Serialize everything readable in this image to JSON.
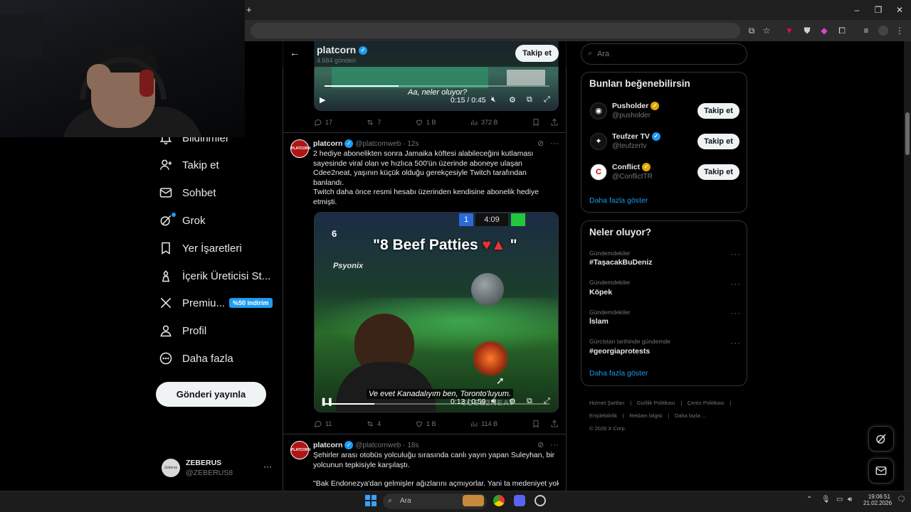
{
  "browser": {
    "new_tab": "+",
    "minimize": "–",
    "maximize": "❐",
    "close": "✕"
  },
  "header": {
    "title": "platcorn",
    "subtitle": "4.684 gönderi",
    "follow": "Takip et"
  },
  "nav": {
    "items": [
      {
        "label": "Bildirimler"
      },
      {
        "label": "Takip et"
      },
      {
        "label": "Sohbet"
      },
      {
        "label": "Grok"
      },
      {
        "label": "Yer İşaretleri"
      },
      {
        "label": "İçerik Üreticisi St..."
      },
      {
        "label": "Premiu..."
      },
      {
        "label": "Profil"
      },
      {
        "label": "Daha fazla"
      }
    ],
    "premium_badge": "%50 indirim",
    "post_button": "Gönderi yayınla",
    "account": {
      "name": "ZEBERUS",
      "handle": "@ZEBERUS8",
      "avatar_text": "Zeberus",
      "more": "···"
    }
  },
  "video1": {
    "caption": "Aa, neler oluyor?",
    "time": "0:15 / 0:45",
    "progress": 0.33
  },
  "tweet1_actions": {
    "replies": "17",
    "reposts": "7",
    "likes": "1 B",
    "views": "372 B"
  },
  "tweet2": {
    "author": "platcorn",
    "handle": "@platcornweb",
    "time": "· 12s",
    "avatar_text": "PLATCORN",
    "text1": "2 hediye abonelikten sonra Jamaika köftesi alabileceğini kutlaması sayesinde viral olan ve hızlıca 500'ün üzerinde aboneye ulaşan Cdee2neat, yaşının küçük olduğu gerekçesiyle Twitch tarafından banlandı.",
    "text2": "Twitch daha önce resmi hesabı üzerinden kendisine abonelik hediye etmişti.",
    "video": {
      "overlay_title": "\"8 Beef Patties",
      "overlay_close": "\"",
      "hud_left": "6",
      "hud_team": "1",
      "hud_clock": "4:09",
      "hud_side": "Psyonix",
      "subtitle": "Ve evet Kanadalıyım ben, Toronto'luyum.",
      "time": "0:13 / 0:59",
      "progress": 0.22,
      "watermark": "CDEE2NEAT"
    },
    "actions": {
      "replies": "11",
      "reposts": "4",
      "likes": "1 B",
      "views": "114 B"
    }
  },
  "tweet3": {
    "author": "platcorn",
    "handle": "@platcornweb",
    "time": "· 18s",
    "avatar_text": "PLATCORN",
    "text1": "Şehirler arası otobüs yolculuğu sırasında canlı yayın yapan Suleyhan, bir yolcunun tepkisiyle karşılaştı.",
    "text2": "\"Bak Endonezya'dan gelmişler ağızlarını açmıyorlar. Yani ta medeniyet yok"
  },
  "search": {
    "placeholder": "Ara"
  },
  "who_to_follow": {
    "title": "Bunları beğenebilirsin",
    "users": [
      {
        "name": "Pusholder",
        "handle": "@pusholder",
        "avatar": "◉",
        "badge": "gold"
      },
      {
        "name": "Teufzer TV",
        "handle": "@teufzertv",
        "avatar": "✦",
        "badge": "blue"
      },
      {
        "name": "Conflict",
        "handle": "@ConflictTR",
        "avatar": "C",
        "badge": "gold"
      }
    ],
    "follow_label": "Takip et",
    "show_more": "Daha fazla göster"
  },
  "trends": {
    "title": "Neler oluyor?",
    "items": [
      {
        "context": "Gündemdekiler",
        "name": "#TaşacakBuDeniz"
      },
      {
        "context": "Gündemdekiler",
        "name": "Köpek"
      },
      {
        "context": "Gündemdekiler",
        "name": "İslam"
      },
      {
        "context": "Gürcistan tarihinde gündemde",
        "name": "#georgiaprotests"
      }
    ],
    "show_more": "Daha fazla göster",
    "more": "···"
  },
  "footer": {
    "links": [
      "Hizmet Şartları",
      "Gizlilik Politikası",
      "Çerez Politikası",
      "Erişilebilirlik",
      "Reklam bilgisi",
      "Daha fazla ..."
    ],
    "sep": "|",
    "copyright": "© 2026 X Corp."
  },
  "taskbar": {
    "search": "Ara",
    "time": "19:06:51",
    "date": "21.02.2026"
  },
  "colors": {
    "accent": "#1d9bf0",
    "background": "#000000",
    "border": "#2f3336"
  }
}
